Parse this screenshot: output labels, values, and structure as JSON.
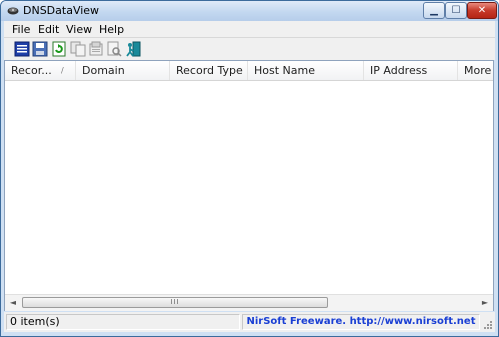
{
  "window": {
    "title": "DNSDataView",
    "app_icon": "disk-icon",
    "buttons": {
      "minimize": "minimize-icon",
      "maximize": "maximize-icon",
      "close": "close-icon"
    }
  },
  "menu": [
    "File",
    "Edit",
    "View",
    "Help"
  ],
  "toolbar": {
    "icons": [
      "properties-icon",
      "save-icon",
      "refresh-icon",
      "copy-icon",
      "html-report-icon",
      "find-icon",
      "exit-icon"
    ]
  },
  "list": {
    "columns": [
      "Recor...",
      "Domain",
      "Record Type",
      "Host Name",
      "IP Address",
      "More"
    ],
    "sort_indicator": "/",
    "rows": []
  },
  "scrollbar": {
    "left_arrow": "◄",
    "right_arrow": "►",
    "grip": "III"
  },
  "status": {
    "items": "0 item(s)",
    "credit": "NirSoft Freeware.  http://www.nirsoft.net"
  }
}
